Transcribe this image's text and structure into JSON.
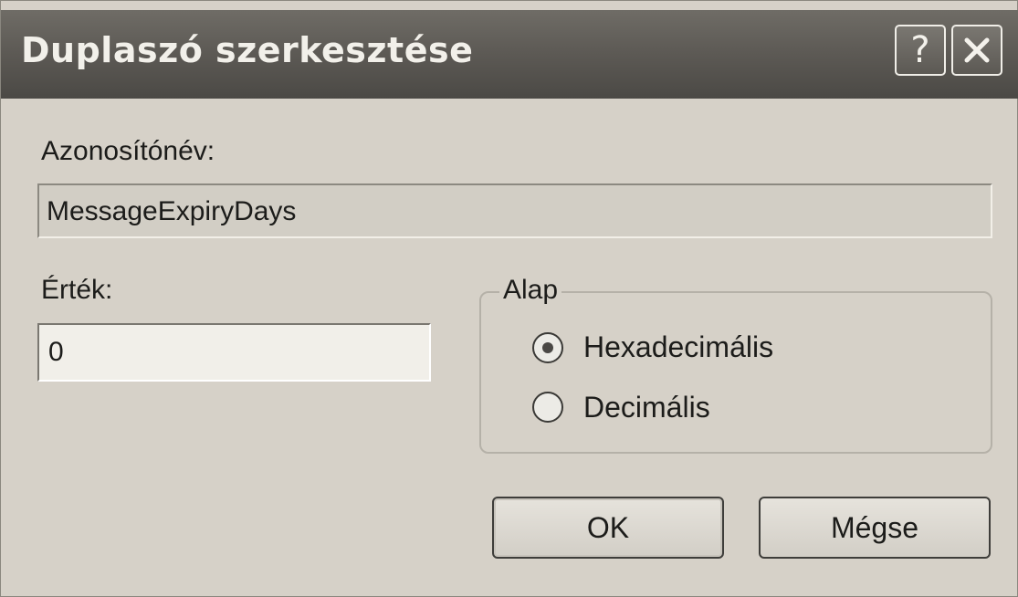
{
  "window": {
    "title": "Duplaszó szerkesztése"
  },
  "titlebar": {
    "help_label": "?",
    "help_icon": "question-mark-icon",
    "close_icon": "close-x-icon"
  },
  "fields": {
    "id_label": "Azonosítónév:",
    "id_value": "MessageExpiryDays",
    "value_label": "Érték:",
    "value_value": "0"
  },
  "base": {
    "legend": "Alap",
    "options": [
      {
        "label": "Hexadecimális",
        "selected": true
      },
      {
        "label": "Decimális",
        "selected": false
      }
    ]
  },
  "buttons": {
    "ok_label": "OK",
    "cancel_label": "Mégse"
  },
  "colors": {
    "titlebar": "#5e5b56",
    "dialog_bg": "#d6d1c8"
  }
}
